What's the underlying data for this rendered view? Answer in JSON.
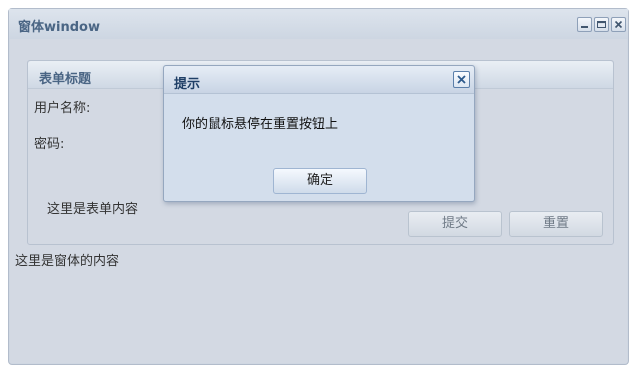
{
  "window": {
    "title": "窗体window",
    "content_text": "这里是窗体的内容"
  },
  "form": {
    "title": "表单标题",
    "username_label": "用户名称:",
    "password_label": "密码:",
    "content_text": "这里是表单内容",
    "submit_label": "提交",
    "reset_label": "重置"
  },
  "dialog": {
    "title": "提示",
    "message": "你的鼠标悬停在重置按钮上",
    "ok_label": "确定"
  },
  "icons": {
    "minimize": "minimize-icon",
    "maximize": "maximize-icon",
    "close": "close-icon"
  }
}
